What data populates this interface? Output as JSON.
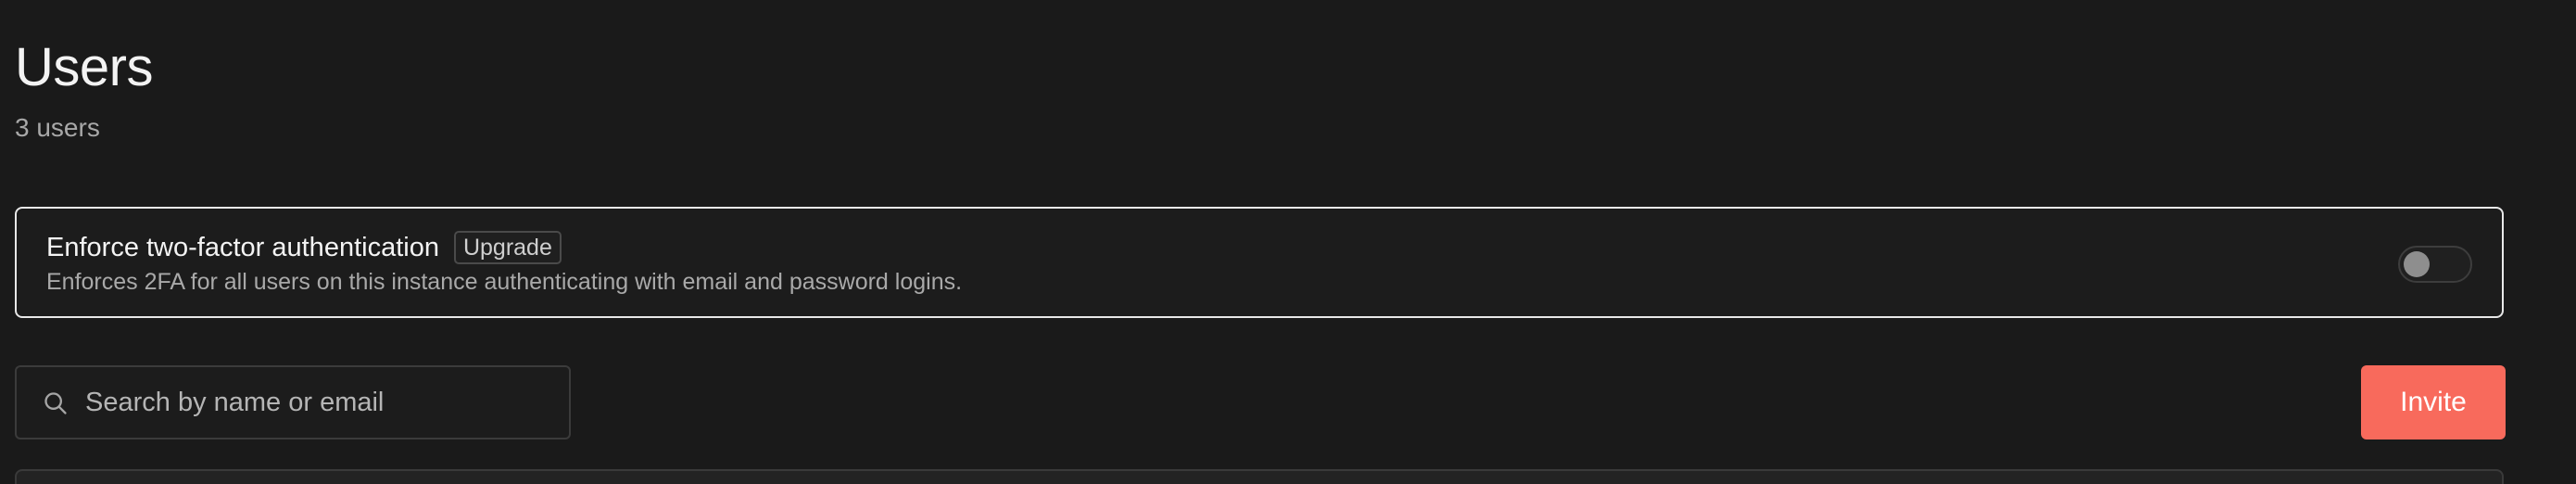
{
  "header": {
    "title": "Users",
    "subtitle": "3 users"
  },
  "two_factor": {
    "title": "Enforce two-factor authentication",
    "badge": "Upgrade",
    "description": "Enforces 2FA for all users on this instance authenticating with email and password logins.",
    "enabled": false
  },
  "search": {
    "placeholder": "Search by name or email",
    "value": "",
    "icon": "search-icon"
  },
  "actions": {
    "invite_label": "Invite"
  },
  "colors": {
    "background": "#1a1a1a",
    "accent": "#f86a5c",
    "card_border": "#e8e8e8"
  }
}
